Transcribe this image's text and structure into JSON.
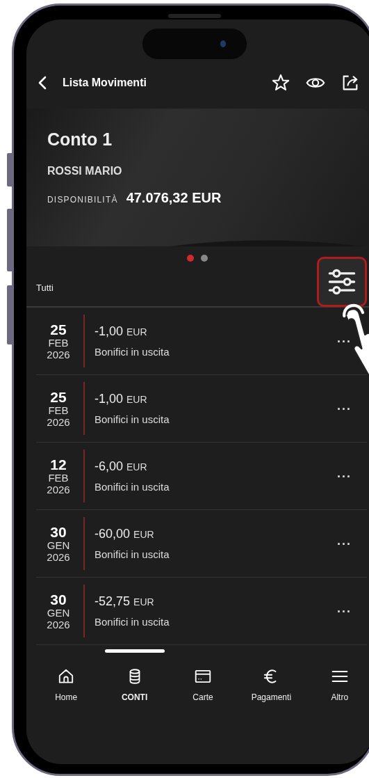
{
  "header": {
    "title": "Lista Movimenti"
  },
  "account": {
    "name": "Conto 1",
    "holder": "ROSSI MARIO",
    "balance_label": "DISPONIBILITÀ",
    "balance": "47.076,32 EUR"
  },
  "pager": [
    {
      "selected": true
    },
    {
      "selected": false
    }
  ],
  "filter": {
    "label": "Tutti",
    "highlighted": true
  },
  "transactions": [
    {
      "day": "25",
      "month": "FEB",
      "year": "2026",
      "amount": "-1,00",
      "currency": "EUR",
      "description": "Bonifici in uscita",
      "more": "..."
    },
    {
      "day": "25",
      "month": "FEB",
      "year": "2026",
      "amount": "-1,00",
      "currency": "EUR",
      "description": "Bonifici in uscita",
      "more": "..."
    },
    {
      "day": "12",
      "month": "FEB",
      "year": "2026",
      "amount": "-6,00",
      "currency": "EUR",
      "description": "Bonifici in uscita",
      "more": "..."
    },
    {
      "day": "30",
      "month": "GEN",
      "year": "2026",
      "amount": "-60,00",
      "currency": "EUR",
      "description": "Bonifici in uscita",
      "more": "..."
    },
    {
      "day": "30",
      "month": "GEN",
      "year": "2026",
      "amount": "-52,75",
      "currency": "EUR",
      "description": "Bonifici in uscita",
      "more": "..."
    }
  ],
  "nav": [
    {
      "kind": "home",
      "label": "Home",
      "selected": false
    },
    {
      "kind": "accounts",
      "label": "CONTI",
      "selected": true
    },
    {
      "kind": "cards",
      "label": "Carte",
      "selected": false
    },
    {
      "kind": "payments",
      "label": "Pagamenti",
      "selected": false
    },
    {
      "kind": "more",
      "label": "Altro",
      "selected": false
    }
  ]
}
